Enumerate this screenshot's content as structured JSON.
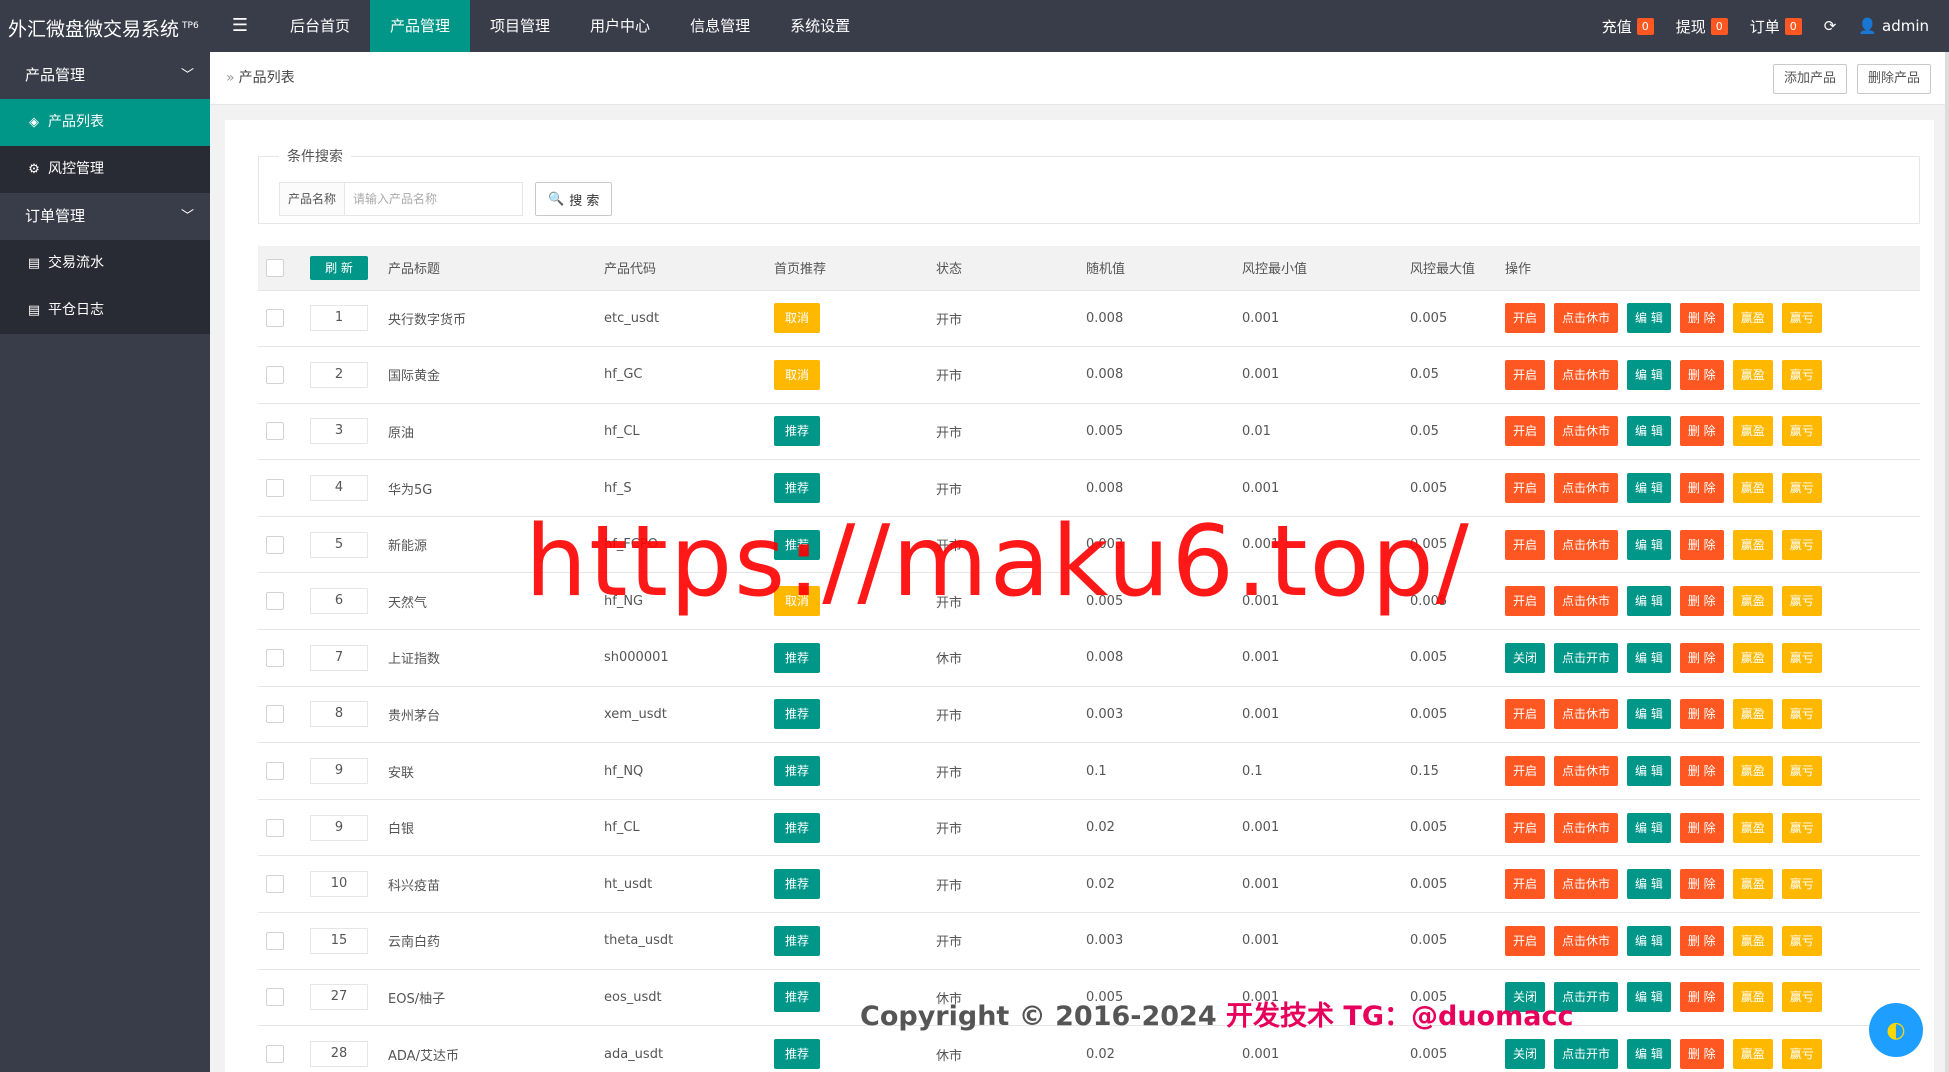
{
  "app": {
    "title": "外汇微盘微交易系统",
    "version_sup": "TP6"
  },
  "topnav": [
    {
      "label": "后台首页",
      "active": false
    },
    {
      "label": "产品管理",
      "active": true
    },
    {
      "label": "项目管理",
      "active": false
    },
    {
      "label": "用户中心",
      "active": false
    },
    {
      "label": "信息管理",
      "active": false
    },
    {
      "label": "系统设置",
      "active": false
    }
  ],
  "topright": {
    "recharge": "充值",
    "recharge_count": "0",
    "withdraw": "提现",
    "withdraw_count": "0",
    "orders": "订单",
    "orders_count": "0",
    "user": "admin"
  },
  "sidebar": {
    "group1": "产品管理",
    "item_product_list": "产品列表",
    "item_risk": "风控管理",
    "group2": "订单管理",
    "item_flow": "交易流水",
    "item_log": "平仓日志"
  },
  "breadcrumb": {
    "current": "产品列表"
  },
  "actions": {
    "add": "添加产品",
    "delete": "删除产品"
  },
  "search": {
    "legend": "条件搜索",
    "label": "产品名称",
    "placeholder": "请输入产品名称",
    "button": "搜 索"
  },
  "table": {
    "refresh": "刷 新",
    "headers": [
      "产品标题",
      "产品代码",
      "首页推荐",
      "状态",
      "随机值",
      "风控最小值",
      "风控最大值",
      "操作"
    ],
    "rows": [
      {
        "idx": "1",
        "title": "央行数字货币",
        "code": "etc_usdt",
        "rec": "取消",
        "status": "开市",
        "random": "0.008",
        "min": "0.001",
        "max": "0.005",
        "toggle": "开启",
        "market": "点击休市"
      },
      {
        "idx": "2",
        "title": "国际黄金",
        "code": "hf_GC",
        "rec": "取消",
        "status": "开市",
        "random": "0.008",
        "min": "0.001",
        "max": "0.05",
        "toggle": "开启",
        "market": "点击休市"
      },
      {
        "idx": "3",
        "title": "原油",
        "code": "hf_CL",
        "rec": "推荐",
        "status": "开市",
        "random": "0.005",
        "min": "0.01",
        "max": "0.05",
        "toggle": "开启",
        "market": "点击休市"
      },
      {
        "idx": "4",
        "title": "华为5G",
        "code": "hf_S",
        "rec": "推荐",
        "status": "开市",
        "random": "0.008",
        "min": "0.001",
        "max": "0.005",
        "toggle": "开启",
        "market": "点击休市"
      },
      {
        "idx": "5",
        "title": "新能源",
        "code": "hf_FCPO",
        "rec": "推荐",
        "status": "开市",
        "random": "0.003",
        "min": "0.001",
        "max": "0.005",
        "toggle": "开启",
        "market": "点击休市"
      },
      {
        "idx": "6",
        "title": "天然气",
        "code": "hf_NG",
        "rec": "取消",
        "status": "开市",
        "random": "0.005",
        "min": "0.001",
        "max": "0.005",
        "toggle": "开启",
        "market": "点击休市"
      },
      {
        "idx": "7",
        "title": "上证指数",
        "code": "sh000001",
        "rec": "推荐",
        "status": "休市",
        "random": "0.008",
        "min": "0.001",
        "max": "0.005",
        "toggle": "关闭",
        "market": "点击开市"
      },
      {
        "idx": "8",
        "title": "贵州茅台",
        "code": "xem_usdt",
        "rec": "推荐",
        "status": "开市",
        "random": "0.003",
        "min": "0.001",
        "max": "0.005",
        "toggle": "开启",
        "market": "点击休市"
      },
      {
        "idx": "9",
        "title": "安联",
        "code": "hf_NQ",
        "rec": "推荐",
        "status": "开市",
        "random": "0.1",
        "min": "0.1",
        "max": "0.15",
        "toggle": "开启",
        "market": "点击休市"
      },
      {
        "idx": "9",
        "title": "白银",
        "code": "hf_CL",
        "rec": "推荐",
        "status": "开市",
        "random": "0.02",
        "min": "0.001",
        "max": "0.005",
        "toggle": "开启",
        "market": "点击休市"
      },
      {
        "idx": "10",
        "title": "科兴疫苗",
        "code": "ht_usdt",
        "rec": "推荐",
        "status": "开市",
        "random": "0.02",
        "min": "0.001",
        "max": "0.005",
        "toggle": "开启",
        "market": "点击休市"
      },
      {
        "idx": "15",
        "title": "云南白药",
        "code": "theta_usdt",
        "rec": "推荐",
        "status": "开市",
        "random": "0.003",
        "min": "0.001",
        "max": "0.005",
        "toggle": "开启",
        "market": "点击休市"
      },
      {
        "idx": "27",
        "title": "EOS/柚子",
        "code": "eos_usdt",
        "rec": "推荐",
        "status": "休市",
        "random": "0.005",
        "min": "0.001",
        "max": "0.005",
        "toggle": "关闭",
        "market": "点击开市"
      },
      {
        "idx": "28",
        "title": "ADA/艾达币",
        "code": "ada_usdt",
        "rec": "推荐",
        "status": "休市",
        "random": "0.02",
        "min": "0.001",
        "max": "0.005",
        "toggle": "关闭",
        "market": "点击开市"
      }
    ],
    "op_edit": "编 辑",
    "op_delete": "删 除",
    "op_win": "赢盈",
    "op_lose": "赢亏"
  },
  "overlay": {
    "watermark": "https://maku6.top/",
    "copyright": "Copyright © 2016-2024",
    "tg": "开发技术 TG：@duomacc"
  },
  "colors": {
    "header": "#393d49",
    "accent": "#009688",
    "orange": "#ff5722",
    "yellow": "#ffb800"
  }
}
